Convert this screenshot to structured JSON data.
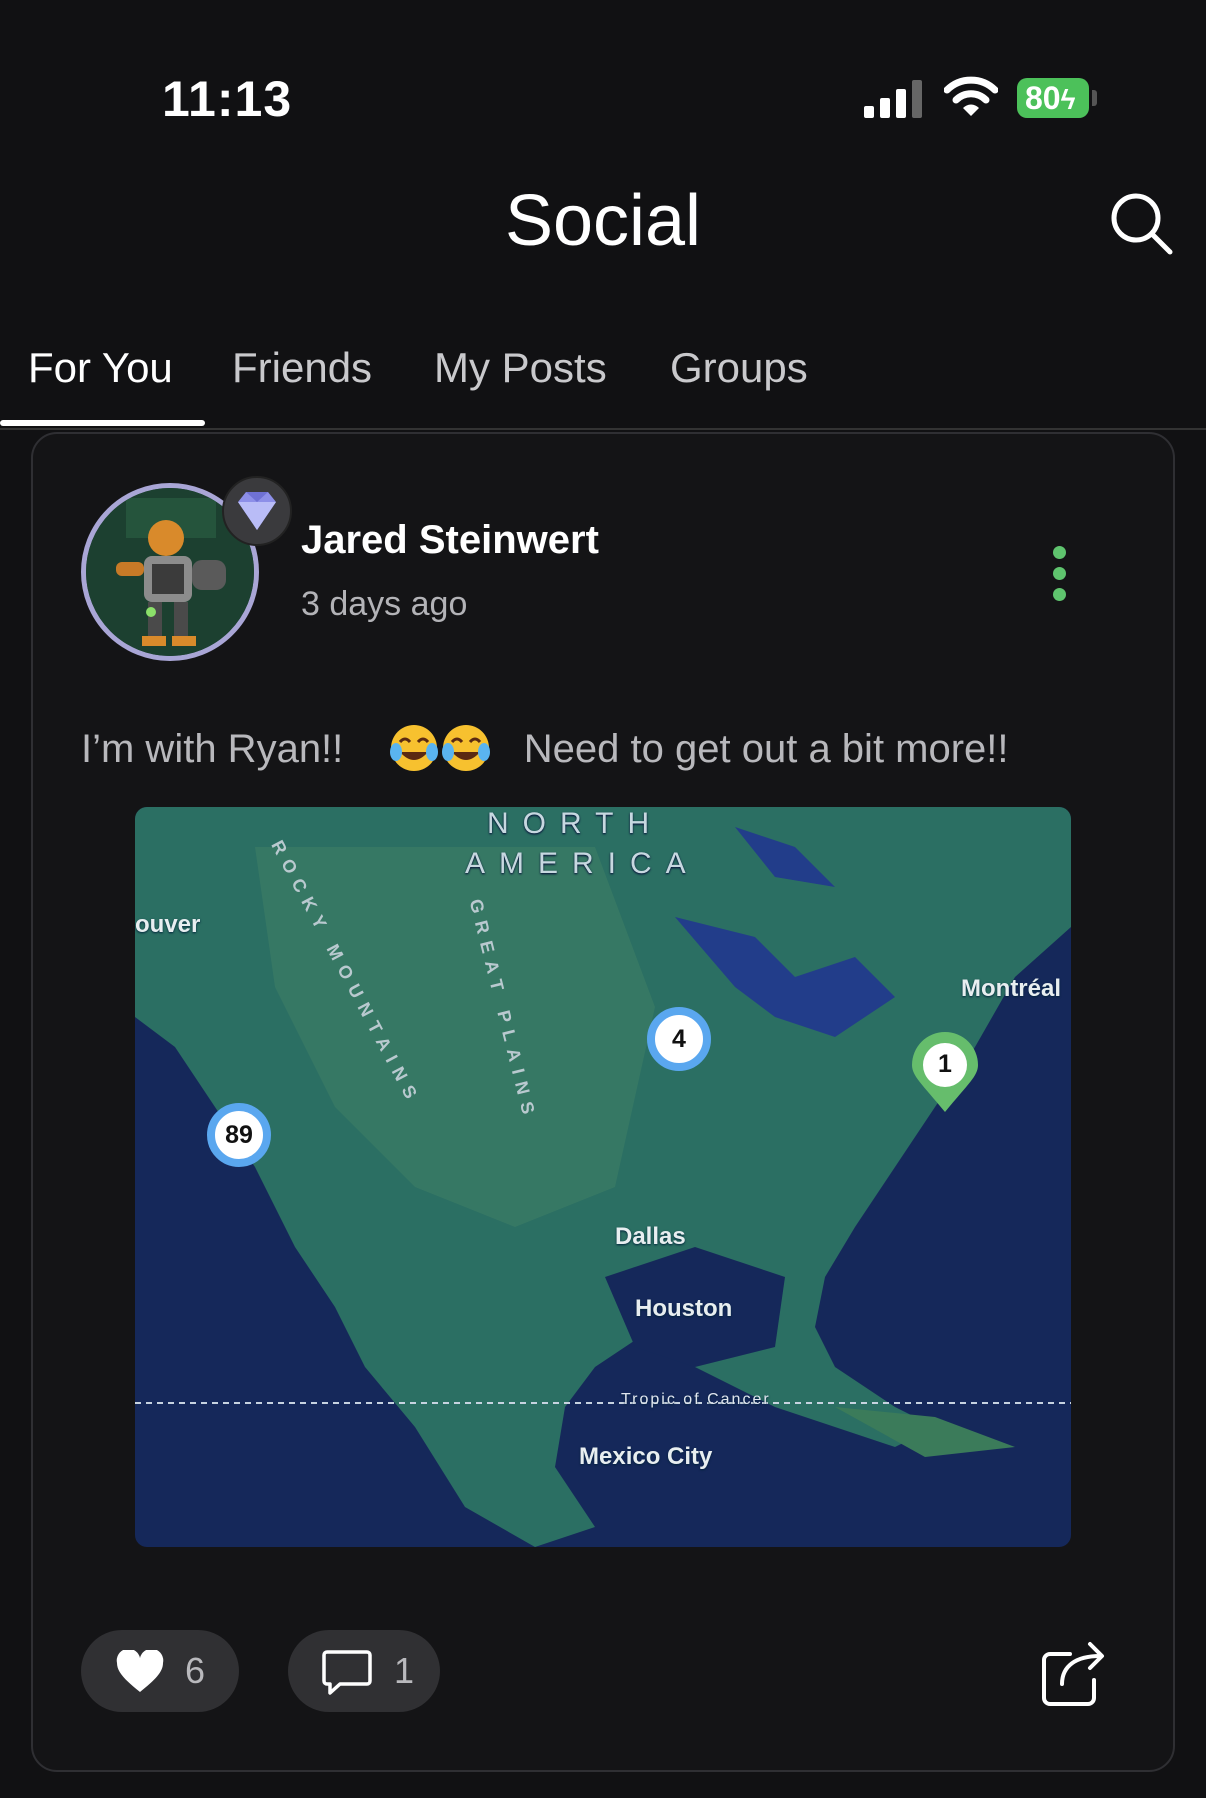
{
  "status_bar": {
    "time": "11:13",
    "battery": "80"
  },
  "header": {
    "title": "Social"
  },
  "tabs": [
    {
      "label": "For You",
      "active": true
    },
    {
      "label": "Friends",
      "active": false
    },
    {
      "label": "My Posts",
      "active": false
    },
    {
      "label": "Groups",
      "active": false
    }
  ],
  "post": {
    "author": "Jared Steinwert",
    "timestamp": "3 days ago",
    "text_before": "I’m with Ryan!!",
    "text_after": "Need to get out a bit more!!",
    "emojis": [
      "face-with-tears-of-joy",
      "face-with-tears-of-joy"
    ],
    "likes": "6",
    "comments": "1",
    "map": {
      "region": [
        "NORTH",
        "AMERICA"
      ],
      "terrain": [
        "ROCKY MOUNTAINS",
        "GREAT PLAINS"
      ],
      "cities": [
        "ouver",
        "Montréal",
        "Dallas",
        "Houston",
        "Mexico City"
      ],
      "tropic": "Tropic of Cancer",
      "markers": [
        "89",
        "4",
        "1"
      ]
    }
  },
  "colors": {
    "accent_green": "#5fc46e",
    "cluster_blue": "#5aa7ef",
    "background": "#111113"
  }
}
